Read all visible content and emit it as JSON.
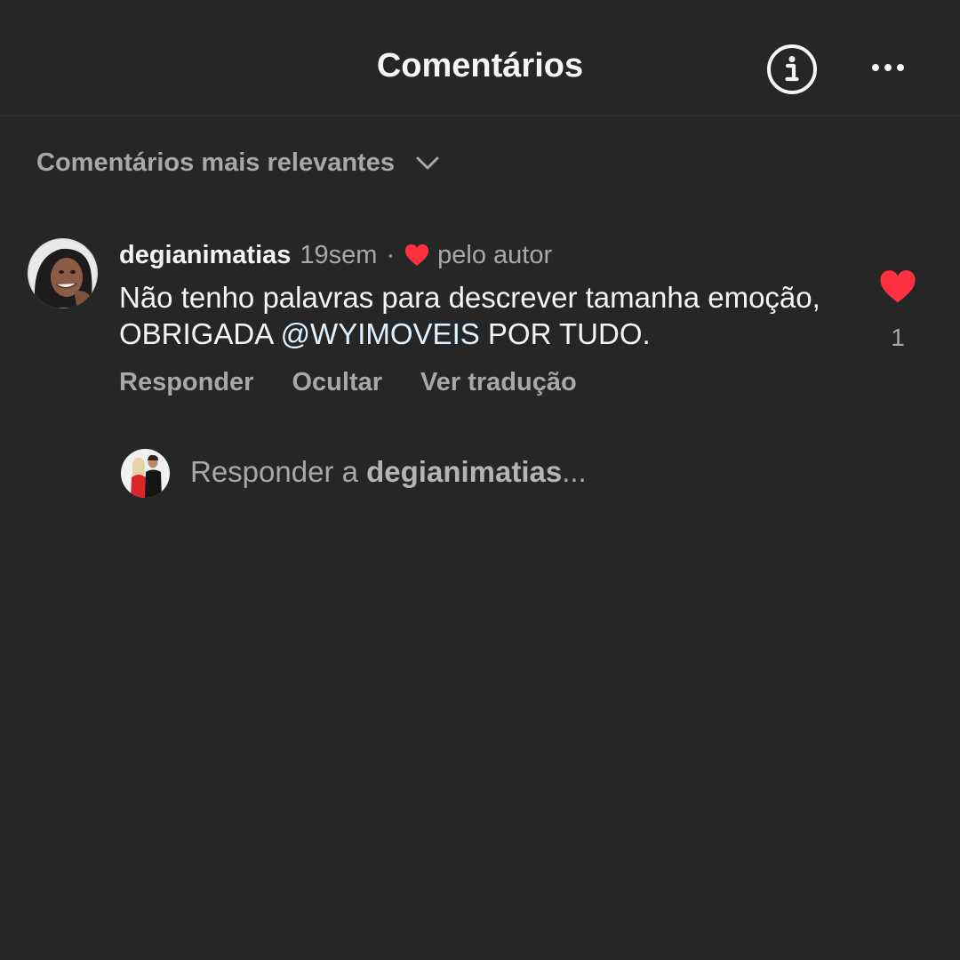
{
  "header": {
    "title": "Comentários",
    "info_icon": "info-circle-icon",
    "more_icon": "more-horizontal-icon"
  },
  "sort": {
    "label": "Comentários mais relevantes",
    "icon": "chevron-down-icon"
  },
  "comment": {
    "username": "degianimatias",
    "time": "19sem",
    "separator": "·",
    "author_like_label": "pelo autor",
    "text_before": "Não tenho palavras para descrever tamanha emoção, OBRIGADA ",
    "mention": "@WYIMOVEIS",
    "text_after": " POR TUDO.",
    "like_count": "1",
    "actions": {
      "reply": "Responder",
      "hide": "Ocultar",
      "translate": "Ver tradução"
    }
  },
  "reply_box": {
    "prefix": "Responder a ",
    "target": "degianimatias",
    "suffix": "..."
  },
  "colors": {
    "background": "#262626",
    "text_primary": "#f5f5f5",
    "text_secondary": "#a8a8a8",
    "heart_red": "#ff3040",
    "mention": "#e0f1ff"
  }
}
